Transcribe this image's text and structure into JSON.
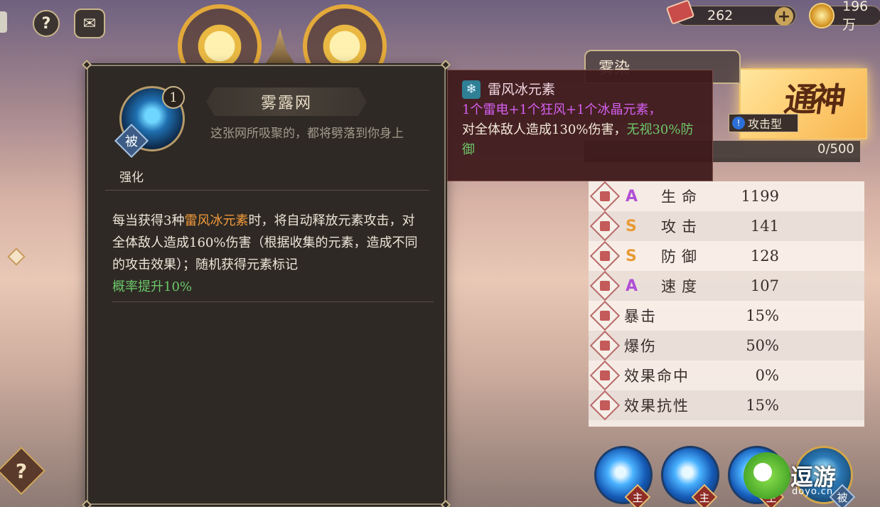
{
  "topbar": {
    "help_glyph": "?",
    "chat_glyph": "✉",
    "currency1_value": "262",
    "currency1_add": "+",
    "currency2_value": "196万"
  },
  "skill_popup": {
    "level": "1",
    "passive_tag": "被",
    "name": "雾露网",
    "flavor": "这张网所吸聚的，都将劈落到你身上",
    "enhance_label": "强化",
    "desc_1": "每当获得3种",
    "desc_hl": "雷风冰元素",
    "desc_2": "时，将自动释放元素攻击，对全体敌人造成160%伤害（根据收集的元素，造成不同的攻击效果）；随机获得元素标记",
    "desc_green": "概率提升10%"
  },
  "tooltip": {
    "icon": "❄",
    "title": "雷风冰元素",
    "formula": "1个雷电+1个狂风+1个冰晶元素，",
    "body": "对全体敌人造成130%伤害，",
    "green": "无视30%防御"
  },
  "hero": {
    "name": "雾染",
    "rank": "通神",
    "type_label": "攻击型",
    "exp": "0/500"
  },
  "stats": [
    {
      "grade": "A",
      "label": "生命",
      "value": "1199"
    },
    {
      "grade": "S",
      "label": "攻击",
      "value": "141"
    },
    {
      "grade": "S",
      "label": "防御",
      "value": "128"
    },
    {
      "grade": "A",
      "label": "速度",
      "value": "107"
    },
    {
      "grade": "",
      "label": "暴击",
      "value": "15%"
    },
    {
      "grade": "",
      "label": "爆伤",
      "value": "50%"
    },
    {
      "grade": "",
      "label": "效果命中",
      "value": "0%"
    },
    {
      "grade": "",
      "label": "效果抗性",
      "value": "15%"
    }
  ],
  "grade_colors": {
    "A": "#b04fd6",
    "S": "#e89a35"
  },
  "skills": [
    {
      "tag": "主"
    },
    {
      "tag": "主"
    },
    {
      "tag": "主"
    },
    {
      "tag": "被"
    }
  ],
  "watermark": {
    "brand": "逗游",
    "site": "doyo.cn"
  },
  "help_button": "?"
}
